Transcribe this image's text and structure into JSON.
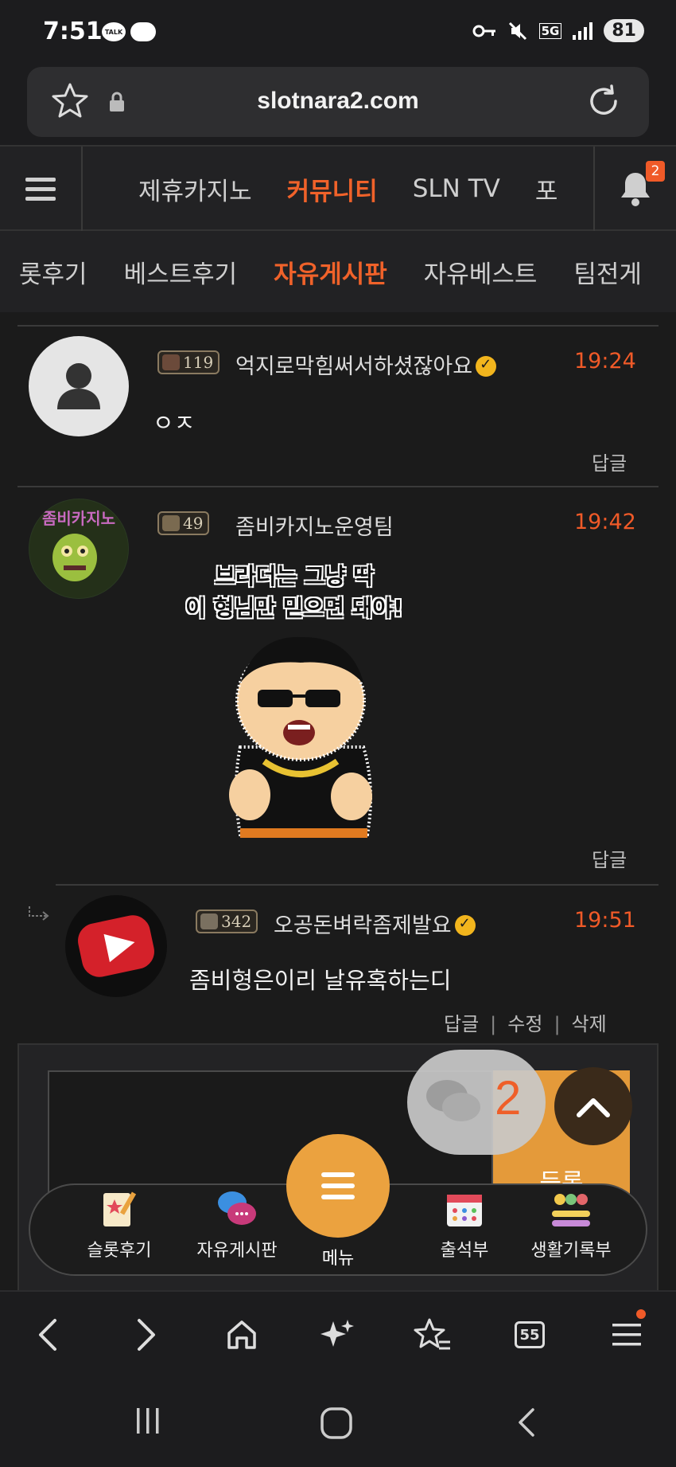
{
  "status_bar": {
    "time": "7:51",
    "talk_label": "TALK",
    "network": "5G",
    "battery": "81"
  },
  "browser": {
    "url": "slotnara2.com",
    "tabs_count": "55"
  },
  "site_nav": {
    "tabs": [
      {
        "label": "제휴카지노",
        "active": false
      },
      {
        "label": "커뮤니티",
        "active": true
      },
      {
        "label": "SLN TV",
        "active": false
      },
      {
        "label": "포",
        "active": false
      }
    ],
    "notification_count": "2"
  },
  "sub_nav": {
    "tabs": [
      {
        "label": "롯후기",
        "active": false
      },
      {
        "label": "베스트후기",
        "active": false
      },
      {
        "label": "자유게시판",
        "active": true
      },
      {
        "label": "자유베스트",
        "active": false
      },
      {
        "label": "팀전게",
        "active": false
      }
    ]
  },
  "comments": [
    {
      "level": "119",
      "author": "억지로막힘써서하셨잖아요",
      "verified": true,
      "time": "19:24",
      "text": "ㅇㅈ",
      "actions": [
        "답글"
      ]
    },
    {
      "level": "49",
      "author": "좀비카지노운영팀",
      "verified": false,
      "time": "19:42",
      "sticker_caption_line1": "브라더는 그냥 딱",
      "sticker_caption_line2": "이 형님만 믿으면 돼야!",
      "avatar_text": "좀비카지노",
      "actions": [
        "답글"
      ]
    },
    {
      "level": "342",
      "author": "오공돈벼락좀제발요",
      "verified": true,
      "time": "19:51",
      "text": "좀비형은이리 날유혹하는디",
      "actions": [
        "답글",
        "수정",
        "삭제"
      ],
      "is_reply": true
    }
  ],
  "comment_form": {
    "submit_label": "등록"
  },
  "floating": {
    "chat_count": "2"
  },
  "bottom_nav": {
    "items": [
      {
        "label": "슬롯후기"
      },
      {
        "label": "자유게시판"
      },
      {
        "label": "메뉴"
      },
      {
        "label": "출석부"
      },
      {
        "label": "생활기록부"
      }
    ]
  },
  "colors": {
    "accent": "#f05a28",
    "menu_orange": "#eba23f",
    "background": "#1b1b1b"
  }
}
